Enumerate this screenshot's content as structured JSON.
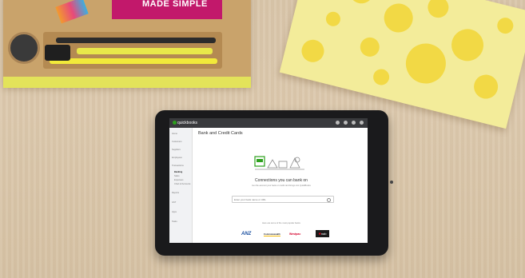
{
  "scene": {
    "props": {
      "card_text": "MADE SIMPLE"
    },
    "colors": {
      "desk": "#dcc9ae",
      "tray_wood": "#c9a36b",
      "tray_edge": "#e3e35a",
      "notebook": "#f3ec9a",
      "notebook_dots": "#f2d945",
      "tablet_frame": "#1a1a1c",
      "brand_green": "#2ca01c"
    }
  },
  "tablet_ui": {
    "topbar": {
      "brand": "quickbooks"
    },
    "sidebar": {
      "items": [
        {
          "label": "Home"
        },
        {
          "label": "Customers"
        },
        {
          "label": "Suppliers"
        },
        {
          "label": "Employees"
        },
        {
          "label": "Transactions"
        },
        {
          "label": "Banking"
        },
        {
          "label": "Sales"
        },
        {
          "label": "Expenses"
        },
        {
          "label": "Chart of Accounts"
        },
        {
          "label": "Reports"
        },
        {
          "label": "GST"
        },
        {
          "label": "Apps"
        },
        {
          "label": "Tasks"
        }
      ]
    },
    "main": {
      "title": "Bank and Credit Cards",
      "heading": "Connections you can bank on",
      "subheading": "Get the account your bank or credit card brings into QuickBooks",
      "search_placeholder": "Enter your bank name or URL",
      "popular_label": "Here are some of the most popular banks",
      "banks": [
        {
          "name": "ANZ",
          "color": "#1a4fa0"
        },
        {
          "name": "Commonwealth",
          "color": "#f2b705"
        },
        {
          "name": "Westpac",
          "color": "#d5002b"
        },
        {
          "name": "nab",
          "color": "#e2001a"
        }
      ]
    }
  }
}
